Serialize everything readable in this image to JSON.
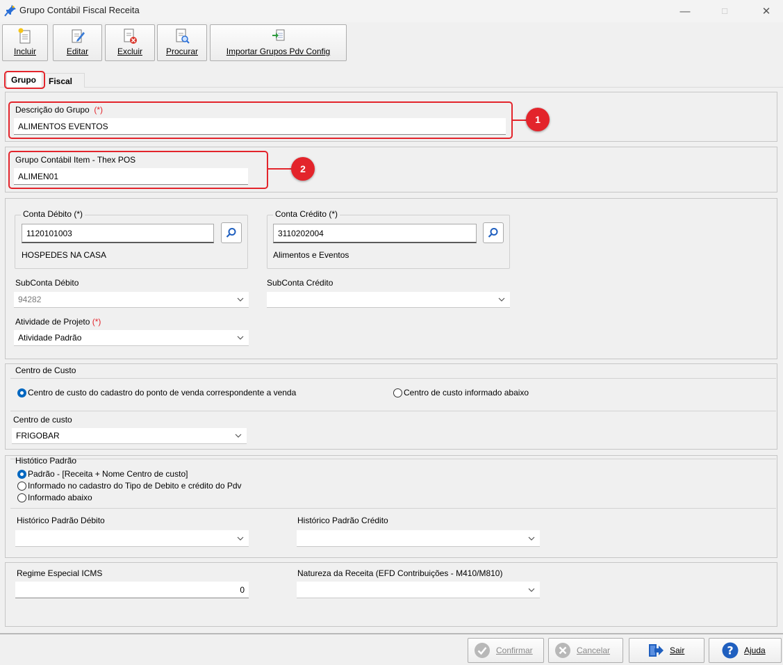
{
  "window": {
    "title": "Grupo Contábil Fiscal Receita",
    "minimize": "—",
    "maximize": "☐",
    "close": "✕"
  },
  "toolbar": {
    "incluir": "Incluir",
    "editar": "Editar",
    "excluir": "Excluir",
    "procurar": "Procurar",
    "importar": "Importar Grupos Pdv Config"
  },
  "tabs": {
    "grupo": "Grupo",
    "fiscal": "Fiscal"
  },
  "grupo": {
    "descricao_label": "Descrição do Grupo",
    "descricao_req": "(*)",
    "descricao_value": "ALIMENTOS EVENTOS",
    "item_label": "Grupo Contábil Item - Thex POS",
    "item_value": "ALIMEN01"
  },
  "badges": {
    "one": "1",
    "two": "2"
  },
  "contas": {
    "debito_label": "Conta Débito (*)",
    "debito_value": "1120101003",
    "debito_desc": "HOSPEDES NA CASA",
    "credito_label": "Conta Crédito (*)",
    "credito_value": "3110202004",
    "credito_desc": "Alimentos e Eventos",
    "subdebito_label": "SubConta Débito",
    "subdebito_value": "94282",
    "subcredito_label": "SubConta Crédito",
    "subcredito_value": "",
    "atividade_label": "Atividade de Projeto",
    "atividade_req": "(*)",
    "atividade_value": "Atividade Padrão"
  },
  "centro": {
    "legend": "Centro de Custo",
    "opt1": "Centro de custo do cadastro do ponto de venda correspondente a venda",
    "opt2": "Centro de custo informado abaixo",
    "cc_label": "Centro de custo",
    "cc_value": "FRIGOBAR"
  },
  "historico": {
    "legend": "Histótico Padrão",
    "opt1": "Padrão - [Receita + Nome Centro de custo]",
    "opt2": "Informado no cadastro do Tipo de Debito e crédito do Pdv",
    "opt3": "Informado abaixo",
    "debito_label": "Histórico Padrão Débito",
    "credito_label": "Histórico Padrão Crédito"
  },
  "regime": {
    "label": "Regime Especial ICMS",
    "value": "0",
    "natureza_label": "Natureza da Receita (EFD Contribuições - M410/M810)"
  },
  "bottom": {
    "confirmar": "Confirmar",
    "cancelar": "Cancelar",
    "sair": "Sair",
    "ajuda": "Ajuda"
  },
  "colors": {
    "accent": "#0067c0",
    "highlight": "#e3242b"
  }
}
